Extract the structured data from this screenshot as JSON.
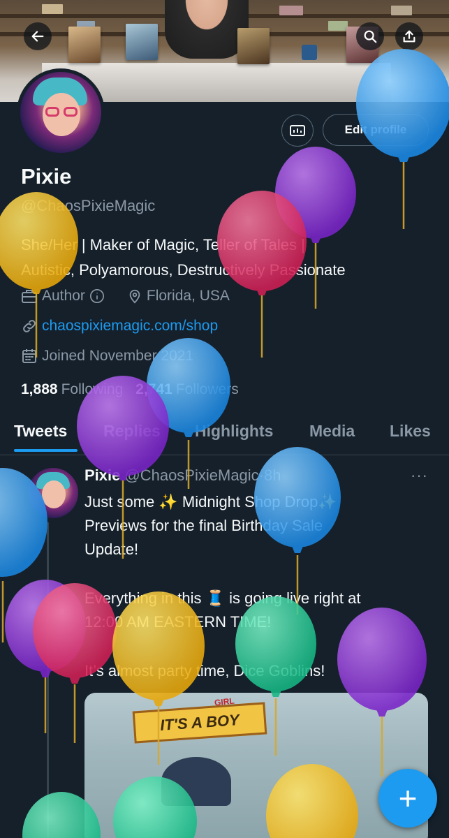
{
  "banner": {
    "book_covers": [
      "INKSPELL",
      "WAYFINDER",
      "KINGMAKER",
      "WORLDS"
    ]
  },
  "header": {
    "back_icon": "arrow-left-icon",
    "search_icon": "search-icon",
    "share_icon": "share-upload-icon"
  },
  "profile": {
    "name": "Pixie",
    "handle": "@ChaosPixieMagic",
    "bio_line1": "She/Her | Maker of Magic, Teller of Tales |",
    "bio_line2": "Autistic, Polyamorous, Destructively Passionate",
    "category": "Author",
    "location": "Florida, USA",
    "website": "chaospixiemagic.com/shop",
    "joined": "Joined November 2021",
    "following_count": "1,888",
    "following_label": "Following",
    "followers_count": "2,741",
    "followers_label": "Followers",
    "edit_label": "Edit profile"
  },
  "tabs": [
    {
      "label": "Tweets",
      "active": true
    },
    {
      "label": "Replies",
      "active": false
    },
    {
      "label": "Highlights",
      "active": false
    },
    {
      "label": "Media",
      "active": false
    },
    {
      "label": "Likes",
      "active": false
    }
  ],
  "tweet": {
    "name": "Pixie",
    "handle": "@ChaosPixieMagic",
    "dot": "·",
    "time": "8h",
    "more": "···",
    "line1": "Just some ✨ Midnight Shop Drop✨",
    "line2": "Previews for the final Birthday Sale",
    "line3": "Update!",
    "line4": "Everything in this 🧵 is going live right at",
    "line5": "12:00 AM EASTERN TIME!",
    "line6": "It’s almost party time, Dice Goblins!",
    "media_sign": "IT'S A BOY",
    "media_sign_overlay": "GIRL"
  },
  "fab": {
    "label": "+"
  },
  "colors": {
    "background": "#15202b",
    "accent": "#1d9bf0",
    "secondary_text": "#8b98a5",
    "divider": "#38444d",
    "balloon_blue": "#3e9ff0",
    "balloon_purple": "#9a3fe0",
    "balloon_red": "#e23b6a",
    "balloon_yellow": "#f0c01a",
    "balloon_green": "#2fd6a0"
  }
}
